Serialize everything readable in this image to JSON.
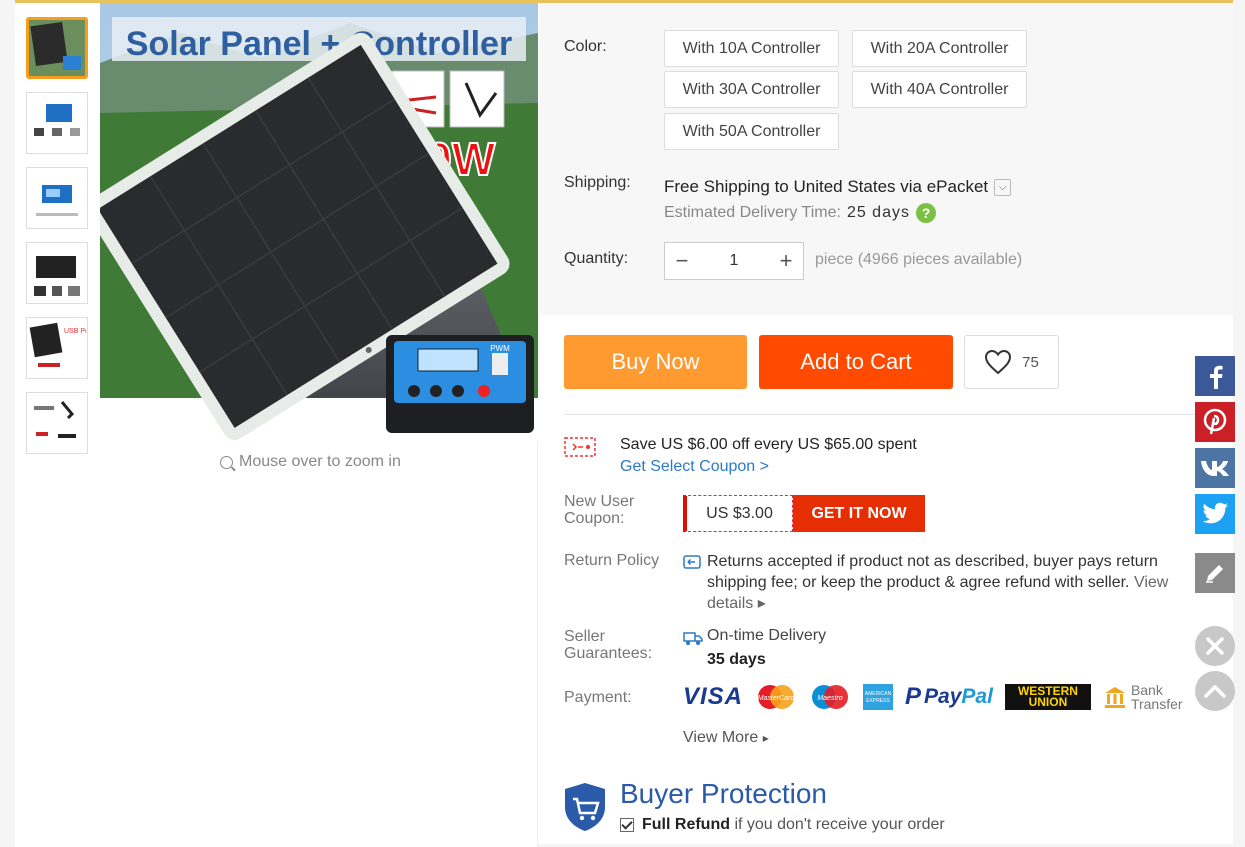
{
  "gallery": {
    "zoom_hint": "Mouse over to zoom in",
    "hero_title": "Solar Panel + Controller",
    "hero_badge": "20W",
    "controller_label": "PWM"
  },
  "product": {
    "color_label": "Color:",
    "color_options": [
      "With 10A Controller",
      "With 20A Controller",
      "With 30A Controller",
      "With 40A Controller",
      "With 50A Controller"
    ],
    "shipping_label": "Shipping:",
    "shipping_main": "Free Shipping to United States via ePacket",
    "delivery_label": "Estimated Delivery Time:",
    "delivery_days": "25 days",
    "quantity_label": "Quantity:",
    "quantity_value": "1",
    "quantity_available": "piece (4966 pieces available)"
  },
  "actions": {
    "buy_now": "Buy Now",
    "add_to_cart": "Add to Cart",
    "wishlist_count": "75"
  },
  "coupon": {
    "save_text": "Save US $6.00 off every US $65.00 spent",
    "link": "Get Select Coupon >",
    "new_user_label_1": "New User",
    "new_user_label_2": "Coupon:",
    "new_user_value": "US $3.00",
    "get_it_now": "GET IT NOW"
  },
  "policy": {
    "return_label": "Return Policy",
    "return_text": "Returns accepted if product not as described, buyer pays return shipping fee; or keep the product & agree refund with seller.",
    "view_details": "View details",
    "seller_label_1": "Seller",
    "seller_label_2": "Guarantees:",
    "ontime": "On-time Delivery",
    "ontime_days": "35 days",
    "payment_label": "Payment:",
    "payment_methods": [
      "VISA",
      "MasterCard",
      "Maestro",
      "American Express",
      "PayPal",
      "WESTERN UNION",
      "Bank Transfer"
    ],
    "view_more": "View More"
  },
  "protection": {
    "title": "Buyer Protection",
    "item1_bold": "Full Refund",
    "item1_rest": "if you don't receive your order"
  },
  "colors": {
    "accent_orange": "#fe9a2f",
    "cart_red": "#ff4a00",
    "link_blue": "#2b7ac9",
    "facebook": "#3b5998",
    "pinterest": "#cb2027",
    "vk": "#4c75a3",
    "twitter": "#1da1f2"
  },
  "social": [
    "facebook-icon",
    "pinterest-icon",
    "vk-icon",
    "twitter-icon",
    "edit-icon",
    "close-icon",
    "scroll-top-icon"
  ]
}
